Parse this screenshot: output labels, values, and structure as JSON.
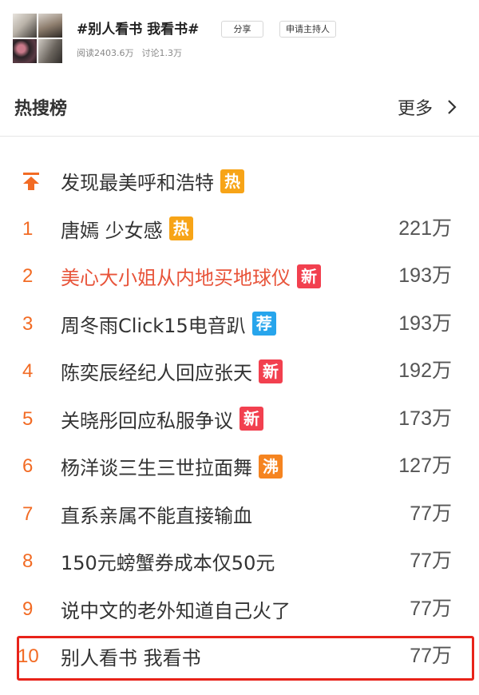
{
  "topic": {
    "title": "#别人看书 我看书#",
    "share_label": "分享",
    "host_label": "申请主持人",
    "reads": "阅读2403.6万",
    "discussions": "讨论1.3万"
  },
  "hot_list": {
    "title": "热搜榜",
    "more_label": "更多",
    "top_item": {
      "text": "发现最美呼和浩特",
      "badge": "热",
      "badge_color": "#f7a417",
      "icon": "pin-top-icon"
    },
    "items": [
      {
        "rank": "1",
        "text": "唐嫣 少女感",
        "badge": "热",
        "badge_color": "#f7a417",
        "count": "221万",
        "text_color": "#333333"
      },
      {
        "rank": "2",
        "text": "美心大小姐从内地买地球仪",
        "badge": "新",
        "badge_color": "#f2404f",
        "count": "193万",
        "text_color": "#e8543a"
      },
      {
        "rank": "3",
        "text": "周冬雨Click15电音趴",
        "badge": "荐",
        "badge_color": "#27a5ec",
        "count": "193万",
        "text_color": "#333333"
      },
      {
        "rank": "4",
        "text": "陈奕辰经纪人回应张天",
        "badge": "新",
        "badge_color": "#f2404f",
        "count": "192万",
        "text_color": "#333333"
      },
      {
        "rank": "5",
        "text": "关晓彤回应私服争议",
        "badge": "新",
        "badge_color": "#f2404f",
        "count": "173万",
        "text_color": "#333333"
      },
      {
        "rank": "6",
        "text": "杨洋谈三生三世拉面舞",
        "badge": "沸",
        "badge_color": "#f58420",
        "count": "127万",
        "text_color": "#333333"
      },
      {
        "rank": "7",
        "text": "直系亲属不能直接输血",
        "badge": "",
        "badge_color": "",
        "count": "77万",
        "text_color": "#333333"
      },
      {
        "rank": "8",
        "text": "150元螃蟹券成本仅50元",
        "badge": "",
        "badge_color": "",
        "count": "77万",
        "text_color": "#333333"
      },
      {
        "rank": "9",
        "text": "说中文的老外知道自己火了",
        "badge": "",
        "badge_color": "",
        "count": "77万",
        "text_color": "#333333"
      },
      {
        "rank": "10",
        "text": "别人看书 我看书",
        "badge": "",
        "badge_color": "",
        "count": "77万",
        "text_color": "#333333"
      }
    ],
    "highlighted_rank": "10",
    "highlight_color": "#e8231a",
    "rank_color": "#f26b24"
  }
}
